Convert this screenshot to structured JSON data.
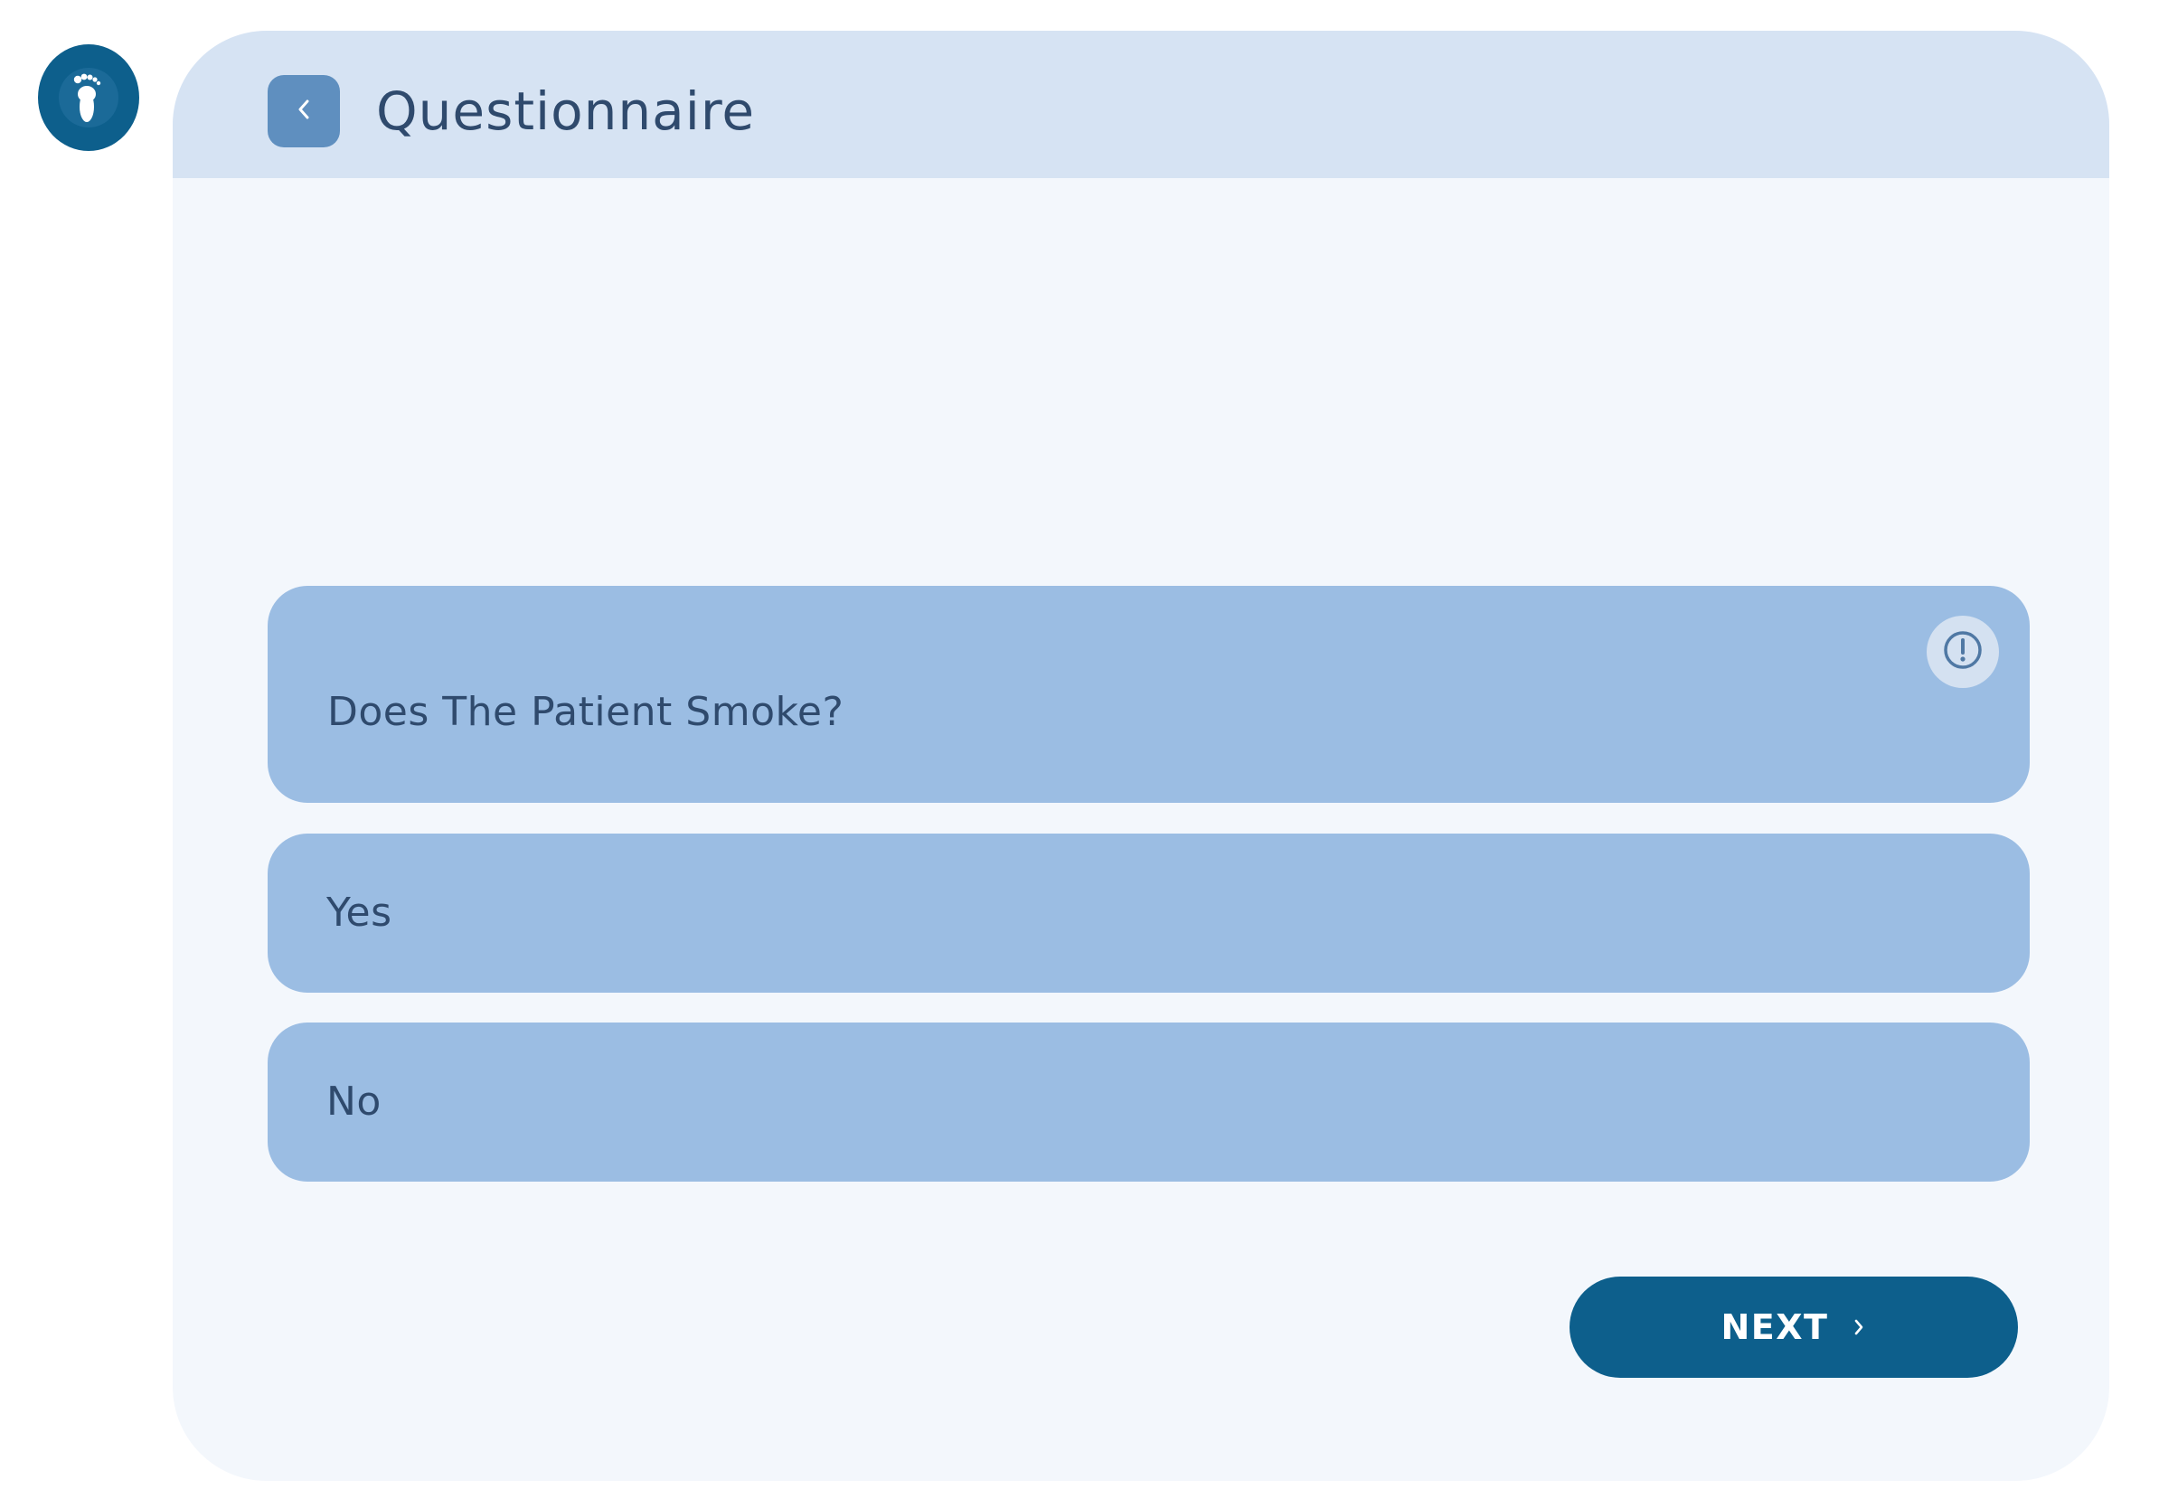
{
  "app": {
    "logo_icon": "foot-icon",
    "brand_color": "#0d5f8c"
  },
  "header": {
    "title": "Questionnaire",
    "back_icon": "chevron-left-icon"
  },
  "question": {
    "text": "Does The Patient Smoke?",
    "info_icon": "exclamation-circle-icon"
  },
  "options": [
    {
      "label": "Yes"
    },
    {
      "label": "No"
    }
  ],
  "footer": {
    "next_label": "NEXT",
    "next_icon": "chevron-right-icon"
  },
  "colors": {
    "card_background": "#f3f7fc",
    "header_background": "#d6e3f3",
    "panel_background": "#9bbde3",
    "text": "#2f4a6d",
    "back_button": "#5f8fbf"
  }
}
